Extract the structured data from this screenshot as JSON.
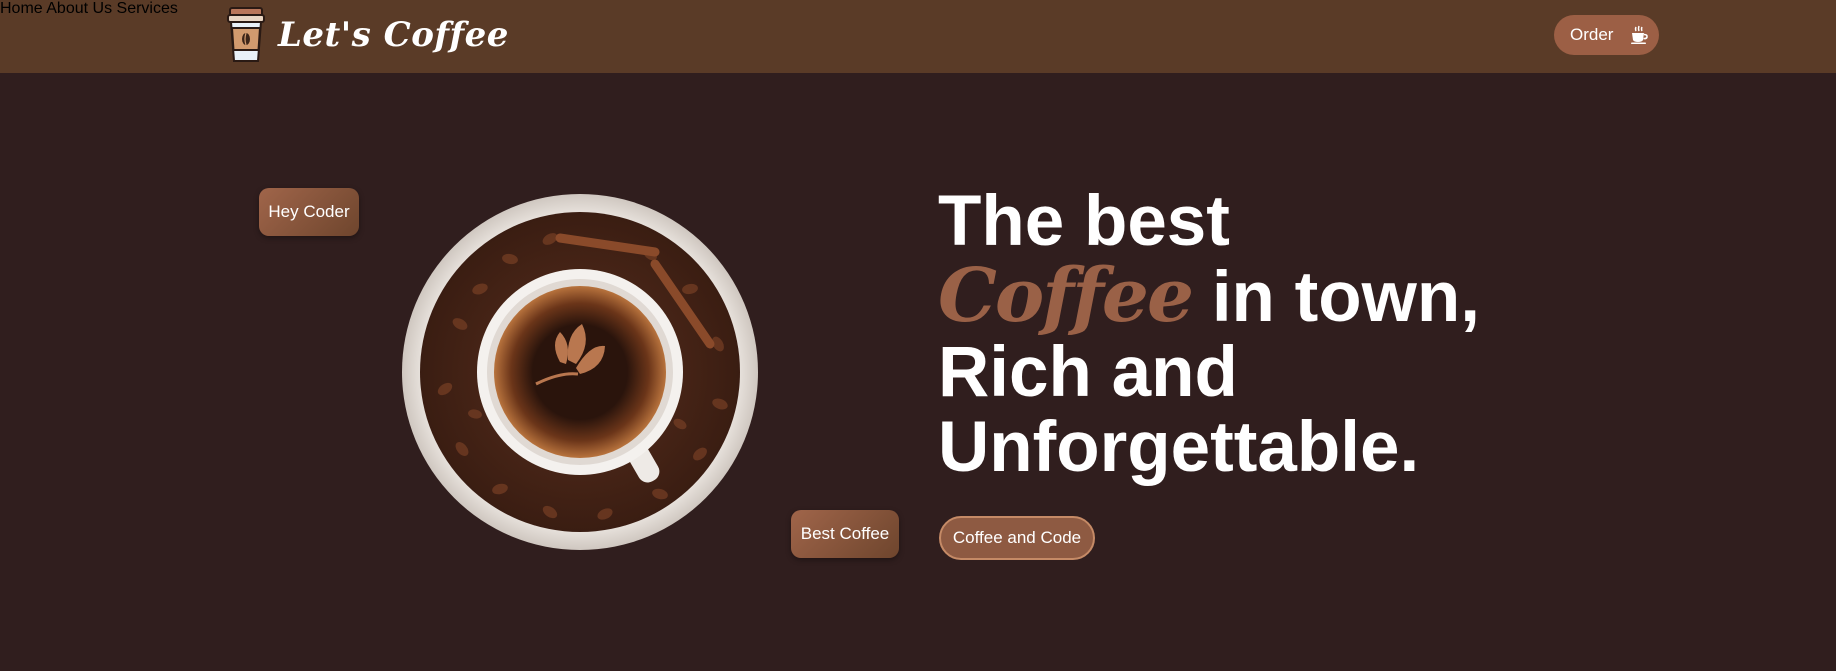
{
  "brand": {
    "name": "Let's Coffee",
    "icon": "coffee-cup-logo-icon"
  },
  "nav": {
    "items": [
      {
        "label": "Home"
      },
      {
        "label": "About Us"
      },
      {
        "label": "Services"
      }
    ],
    "order_label": "Order",
    "order_icon": "coffee-cup-icon"
  },
  "hero": {
    "tag_top": "Hey Coder",
    "tag_bottom": "Best Coffee",
    "headline_line1": "The best",
    "headline_coffee": "Coffee",
    "headline_line2_rest": " in town,",
    "headline_line3": "Rich and",
    "headline_line4": "Unforgettable.",
    "cta_label": "Coffee and Code",
    "image_icon": "coffee-cup-with-beans-image"
  },
  "colors": {
    "background": "#301e1e",
    "header": "#5a3b27",
    "accent": "#9a6147",
    "text": "#ffffff"
  }
}
